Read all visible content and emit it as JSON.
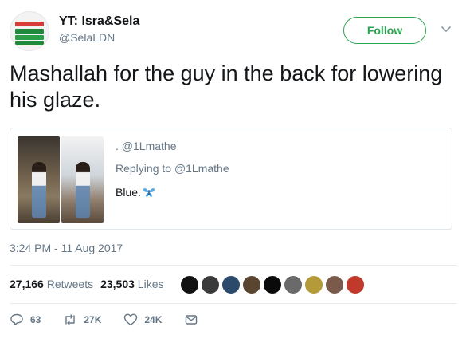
{
  "user": {
    "display_name": "YT: Isra&Sela",
    "handle": "@SelaLDN",
    "avatar_lines": [
      "DO SUBSCRIBE!",
      "YouTube channel:",
      "Isra&sela"
    ]
  },
  "follow_label": "Follow",
  "tweet_text": "Mashallah for the guy in the back for lowering his glaze.",
  "quote": {
    "handle": ". @1Lmathe",
    "reply_prefix": "Replying to",
    "reply_handle": "@1Lmathe",
    "text": "Blue."
  },
  "timestamp": "3:24 PM - 11 Aug 2017",
  "stats": {
    "retweets_count": "27,166",
    "retweets_label": "Retweets",
    "likes_count": "23,503",
    "likes_label": "Likes"
  },
  "actions": {
    "replies": "63",
    "retweets": "27K",
    "likes": "24K"
  },
  "colors": {
    "accent_green": "#2aa44f",
    "text_primary": "#14171a",
    "text_secondary": "#657786"
  },
  "liker_faces": [
    "#111111",
    "#3a3a3a",
    "#2b4a6b",
    "#5a4630",
    "#0a0a0a",
    "#6a6a6a",
    "#b59a3a",
    "#7a5a4a",
    "#c0392b"
  ]
}
